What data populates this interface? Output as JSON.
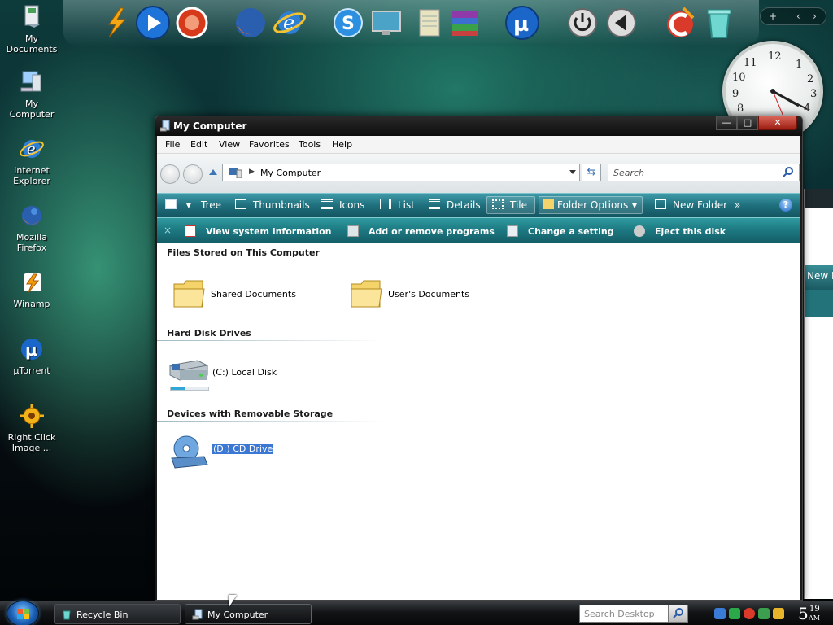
{
  "desktop": {
    "icons": [
      {
        "label": "My Documents",
        "icon": "my-documents-icon"
      },
      {
        "label": "My Computer",
        "icon": "my-computer-icon"
      },
      {
        "label": "Internet Explorer",
        "icon": "internet-explorer-icon"
      },
      {
        "label": "Mozilla Firefox",
        "icon": "firefox-icon"
      },
      {
        "label": "Winamp",
        "icon": "winamp-icon"
      },
      {
        "label": "µTorrent",
        "icon": "utorrent-icon"
      },
      {
        "label": "Right Click Image ...",
        "icon": "right-click-image-icon"
      }
    ]
  },
  "dock": {
    "items": [
      "winamp-icon",
      "media-player-icon",
      "real-player-icon",
      "firefox-icon",
      "internet-explorer-icon",
      "skype-icon",
      "monitor-icon",
      "notepad-icon",
      "winrar-icon",
      "utorrent-icon",
      "power-icon",
      "volume-icon",
      "ccleaner-icon",
      "recycle-bin-icon"
    ],
    "mini_panel": {
      "add": "+",
      "prev": "‹",
      "next": "›"
    }
  },
  "clock_widget": {
    "numbers": {
      "12": "12",
      "1": "1",
      "2": "2",
      "3": "3",
      "4": "4",
      "8": "8",
      "9": "9",
      "10": "10",
      "11": "11"
    }
  },
  "background_window": {
    "partial_label": "New F"
  },
  "window": {
    "title": "My Computer",
    "caption": {
      "minimize": "—",
      "maximize": "□",
      "close": "✕"
    },
    "menu": [
      "File",
      "Edit",
      "View",
      "Favorites",
      "Tools",
      "Help"
    ],
    "address": {
      "path": "My Computer",
      "search_placeholder": "Search"
    },
    "toolbar": {
      "tree": "Tree",
      "thumbnails": "Thumbnails",
      "icons": "Icons",
      "list": "List",
      "details": "Details",
      "tile": "Tile",
      "folder_options": "Folder Options",
      "new_folder": "New Folder",
      "more": "»",
      "help": "?"
    },
    "tasks": {
      "close": "×",
      "view_system_information": "View system information",
      "add_or_remove_programs": "Add or remove programs",
      "change_a_setting": "Change a setting",
      "eject_this_disk": "Eject this disk"
    },
    "groups": {
      "files": {
        "header": "Files Stored on This Computer",
        "items": [
          {
            "label": "Shared Documents"
          },
          {
            "label": "User's Documents"
          }
        ]
      },
      "hdd": {
        "header": "Hard Disk Drives",
        "items": [
          {
            "label": "(C:) Local Disk",
            "usage_fraction": 0.4
          }
        ]
      },
      "removable": {
        "header": "Devices with Removable Storage",
        "items": [
          {
            "label": "(D:) CD Drive",
            "selected": true
          }
        ]
      }
    }
  },
  "taskbar": {
    "buttons": [
      {
        "label": "Recycle Bin"
      },
      {
        "label": "My Computer",
        "active": true
      }
    ],
    "search_placeholder": "Search Desktop",
    "clock": {
      "hour": "5",
      "minute": "19",
      "ampm": "AM"
    }
  }
}
